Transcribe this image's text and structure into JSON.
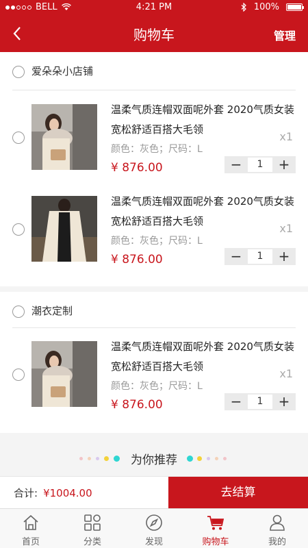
{
  "status_bar": {
    "carrier": "BELL",
    "time": "4:21 PM",
    "battery": "100%"
  },
  "nav": {
    "title": "购物车",
    "manage": "管理"
  },
  "shops": [
    {
      "name": "爱朵朵小店铺",
      "items": [
        {
          "name": "温柔气质连帽双面呢外套 2020气质女装宽松舒适百搭大毛领",
          "spec": "颜色：灰色；尺码：L",
          "price": "¥ 876.00",
          "count_label": "x1",
          "quantity": "1"
        },
        {
          "name": "温柔气质连帽双面呢外套 2020气质女装宽松舒适百搭大毛领",
          "spec": "颜色：灰色；尺码：L",
          "price": "¥ 876.00",
          "count_label": "x1",
          "quantity": "1"
        }
      ]
    },
    {
      "name": "潮衣定制",
      "items": [
        {
          "name": "温柔气质连帽双面呢外套 2020气质女装宽松舒适百搭大毛领",
          "spec": "颜色：灰色；尺码：L",
          "price": "¥ 876.00",
          "count_label": "x1",
          "quantity": "1"
        }
      ]
    }
  ],
  "recommend": {
    "label": "为你推荐"
  },
  "checkout": {
    "total_label": "合计:",
    "total_amount": "¥1004.00",
    "button": "去结算"
  },
  "tabs": [
    {
      "label": "首页",
      "icon": "home-icon"
    },
    {
      "label": "分类",
      "icon": "category-icon"
    },
    {
      "label": "发现",
      "icon": "compass-icon"
    },
    {
      "label": "购物车",
      "icon": "cart-icon",
      "active": true
    },
    {
      "label": "我的",
      "icon": "user-icon"
    }
  ],
  "colors": {
    "accent": "#c8161d",
    "muted": "#999999"
  }
}
